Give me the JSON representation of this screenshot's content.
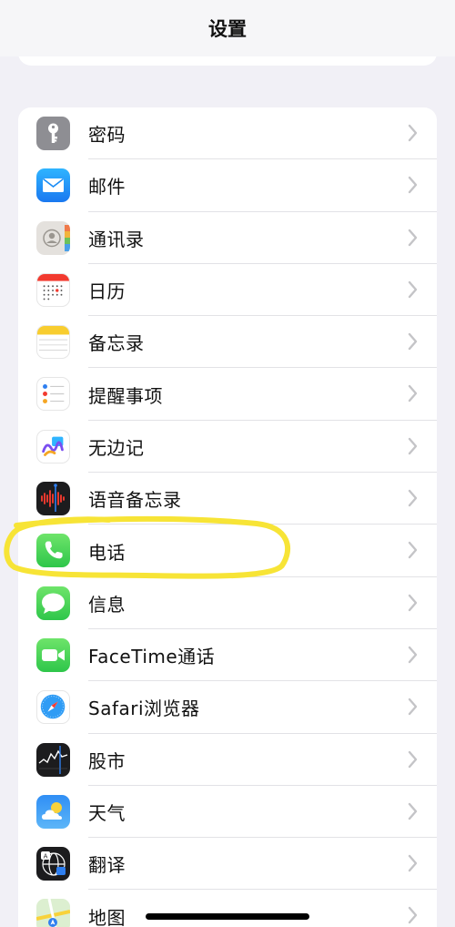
{
  "nav": {
    "title": "设置"
  },
  "rows": [
    {
      "label": "密码"
    },
    {
      "label": "邮件"
    },
    {
      "label": "通讯录"
    },
    {
      "label": "日历"
    },
    {
      "label": "备忘录"
    },
    {
      "label": "提醒事项"
    },
    {
      "label": "无边记"
    },
    {
      "label": "语音备忘录"
    },
    {
      "label": "电话"
    },
    {
      "label": "信息"
    },
    {
      "label": "FaceTime通话"
    },
    {
      "label": "Safari浏览器"
    },
    {
      "label": "股市"
    },
    {
      "label": "天气"
    },
    {
      "label": "翻译"
    },
    {
      "label": "地图"
    }
  ],
  "icons": [
    "key-icon",
    "mail-icon",
    "contacts-icon",
    "calendar-icon",
    "notes-icon",
    "reminders-icon",
    "freeform-icon",
    "voice-memos-icon",
    "phone-icon",
    "messages-icon",
    "facetime-icon",
    "safari-icon",
    "stocks-icon",
    "weather-icon",
    "translate-icon",
    "maps-icon"
  ],
  "colors": {
    "highlight": "#f7e436",
    "background": "#f1f0f6"
  }
}
